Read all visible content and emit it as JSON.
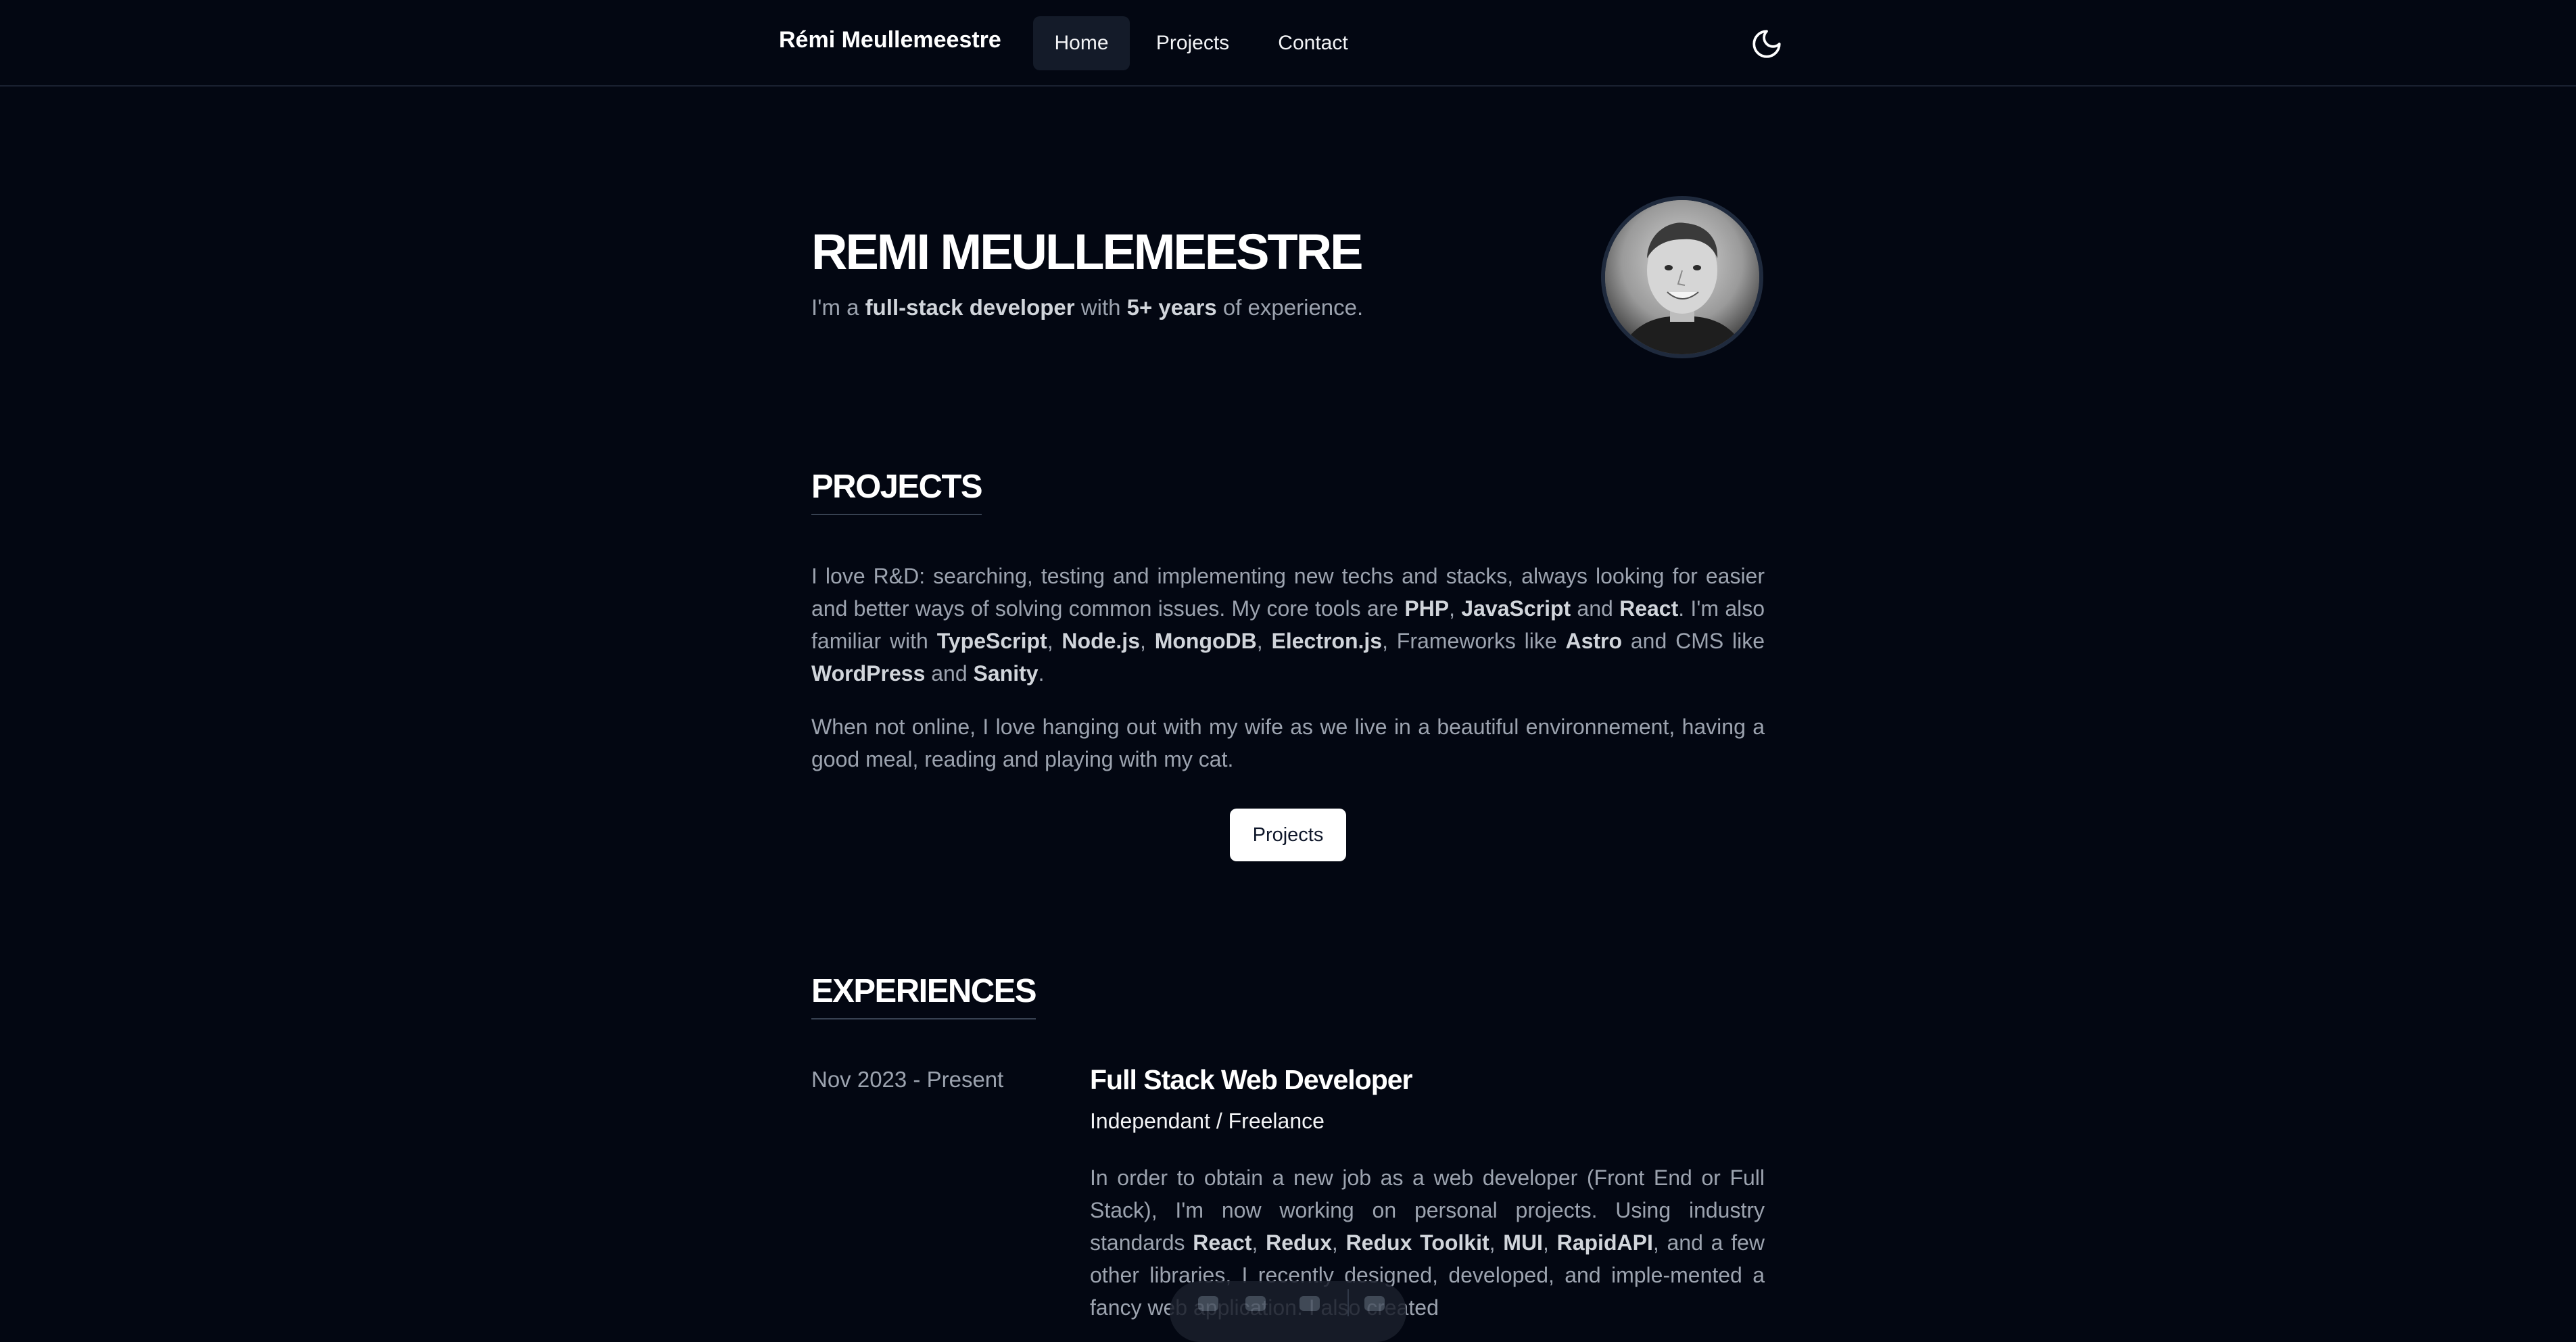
{
  "header": {
    "brand": "Rémi Meullemeestre",
    "nav": {
      "home": "Home",
      "projects": "Projects",
      "contact": "Contact"
    },
    "theme_toggle_icon": "moon-icon"
  },
  "hero": {
    "name": "REMI MEULLEMEESTRE",
    "tagline": {
      "p1": "I'm a ",
      "b1": "full-stack developer",
      "p2": " with ",
      "b2": "5+ years",
      "p3": " of experience."
    },
    "avatar_icon": "avatar-photo"
  },
  "projects": {
    "title": "PROJECTS",
    "para1": {
      "s1": "I love R&D: searching, testing and implementing new techs and stacks, always looking for easier and better ways of solving common issues. My core tools are ",
      "b1": "PHP",
      "s2": ", ",
      "b2": "JavaScript",
      "s3": " and ",
      "b3": "React",
      "s4": ". I'm also familiar with ",
      "b4": "TypeScript",
      "s5": ", ",
      "b5": "Node.js",
      "s6": ", ",
      "b6": "MongoDB",
      "s7": ", ",
      "b7": "Electron.js",
      "s8": ", Frameworks like ",
      "b8": "Astro",
      "s9": " and CMS like ",
      "b9": "WordPress",
      "s10": " and ",
      "b10": "Sanity",
      "s11": "."
    },
    "para2": "When not online, I love hanging out with my wife as we live in a beautiful environnement, having a good meal, reading and playing with my cat.",
    "button": "Projects"
  },
  "experiences": {
    "title": "EXPERIENCES",
    "items": [
      {
        "date": "Nov 2023 - Present",
        "role": "Full Stack Web Developer",
        "company": "Independant / Freelance",
        "desc": {
          "s1": "In order to obtain a new job as a web developer (Front End or Full Stack), I'm now working on personal projects. Using industry standards ",
          "b1": "React",
          "s2": ", ",
          "b2": "Redux",
          "s3": ", ",
          "b3": "Redux Toolkit",
          "s4": ", ",
          "b4": "MUI",
          "s5": ", ",
          "b5": "RapidAPI",
          "s6": ", and a few other libraries, I recently designed, developed, and imple-mented a fancy web application. I also created"
        }
      }
    ]
  },
  "colors": {
    "background": "#030712",
    "text_muted": "#9ca3af",
    "text_strong": "#ffffff",
    "nav_active_bg": "#141b29"
  }
}
